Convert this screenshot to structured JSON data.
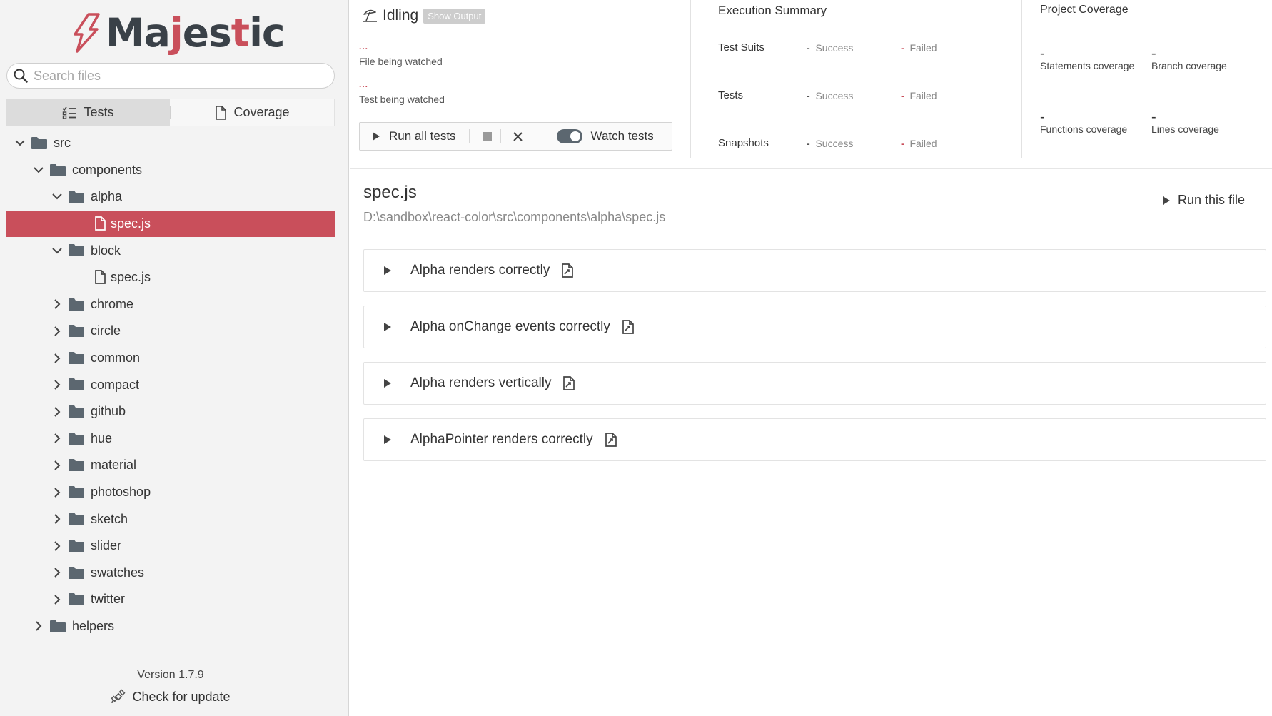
{
  "app": {
    "logo_text": "Majestic",
    "brand_color": "#c94f5b"
  },
  "sidebar": {
    "search_placeholder": "Search files",
    "tabs": [
      {
        "label": "Tests",
        "icon": "tasks-icon",
        "active": true
      },
      {
        "label": "Coverage",
        "icon": "file-icon",
        "active": false
      }
    ],
    "tree": [
      {
        "label": "src",
        "type": "folder",
        "expanded": true,
        "depth": 0
      },
      {
        "label": "components",
        "type": "folder",
        "expanded": true,
        "depth": 1
      },
      {
        "label": "alpha",
        "type": "folder",
        "expanded": true,
        "depth": 2
      },
      {
        "label": "spec.js",
        "type": "file",
        "selected": true,
        "depth": 3
      },
      {
        "label": "block",
        "type": "folder",
        "expanded": true,
        "depth": 2
      },
      {
        "label": "spec.js",
        "type": "file",
        "selected": false,
        "depth": 3
      },
      {
        "label": "chrome",
        "type": "folder",
        "expanded": false,
        "depth": 2
      },
      {
        "label": "circle",
        "type": "folder",
        "expanded": false,
        "depth": 2
      },
      {
        "label": "common",
        "type": "folder",
        "expanded": false,
        "depth": 2
      },
      {
        "label": "compact",
        "type": "folder",
        "expanded": false,
        "depth": 2
      },
      {
        "label": "github",
        "type": "folder",
        "expanded": false,
        "depth": 2
      },
      {
        "label": "hue",
        "type": "folder",
        "expanded": false,
        "depth": 2
      },
      {
        "label": "material",
        "type": "folder",
        "expanded": false,
        "depth": 2
      },
      {
        "label": "photoshop",
        "type": "folder",
        "expanded": false,
        "depth": 2
      },
      {
        "label": "sketch",
        "type": "folder",
        "expanded": false,
        "depth": 2
      },
      {
        "label": "slider",
        "type": "folder",
        "expanded": false,
        "depth": 2
      },
      {
        "label": "swatches",
        "type": "folder",
        "expanded": false,
        "depth": 2
      },
      {
        "label": "twitter",
        "type": "folder",
        "expanded": false,
        "depth": 2
      },
      {
        "label": "helpers",
        "type": "folder",
        "expanded": false,
        "depth": 1
      }
    ],
    "version": "Version 1.7.9",
    "check_update": "Check for update"
  },
  "status": {
    "title": "Idling",
    "show_output": "Show Output",
    "dots": "...",
    "file_watched": "File being watched",
    "test_watched": "Test being watched",
    "run_all": "Run all tests",
    "watch_tests": "Watch tests",
    "watch_on": true
  },
  "execution": {
    "title": "Execution Summary",
    "rows": [
      {
        "name": "Test Suits",
        "success_value": "-",
        "success_label": "Success",
        "failed_value": "-",
        "failed_label": "Failed"
      },
      {
        "name": "Tests",
        "success_value": "-",
        "success_label": "Success",
        "failed_value": "-",
        "failed_label": "Failed"
      },
      {
        "name": "Snapshots",
        "success_value": "-",
        "success_label": "Success",
        "failed_value": "-",
        "failed_label": "Failed"
      }
    ]
  },
  "coverage": {
    "title": "Project Coverage",
    "items": [
      {
        "value": "-",
        "label": "Statements coverage"
      },
      {
        "value": "-",
        "label": "Branch coverage"
      },
      {
        "value": "-",
        "label": "Functions coverage"
      },
      {
        "value": "-",
        "label": "Lines coverage"
      }
    ]
  },
  "main": {
    "file_name": "spec.js",
    "file_path": "D:\\sandbox\\react-color\\src\\components\\alpha\\spec.js",
    "run_file": "Run this file",
    "tests": [
      "Alpha renders correctly",
      "Alpha onChange events correctly",
      "Alpha renders vertically",
      "AlphaPointer renders correctly"
    ]
  }
}
